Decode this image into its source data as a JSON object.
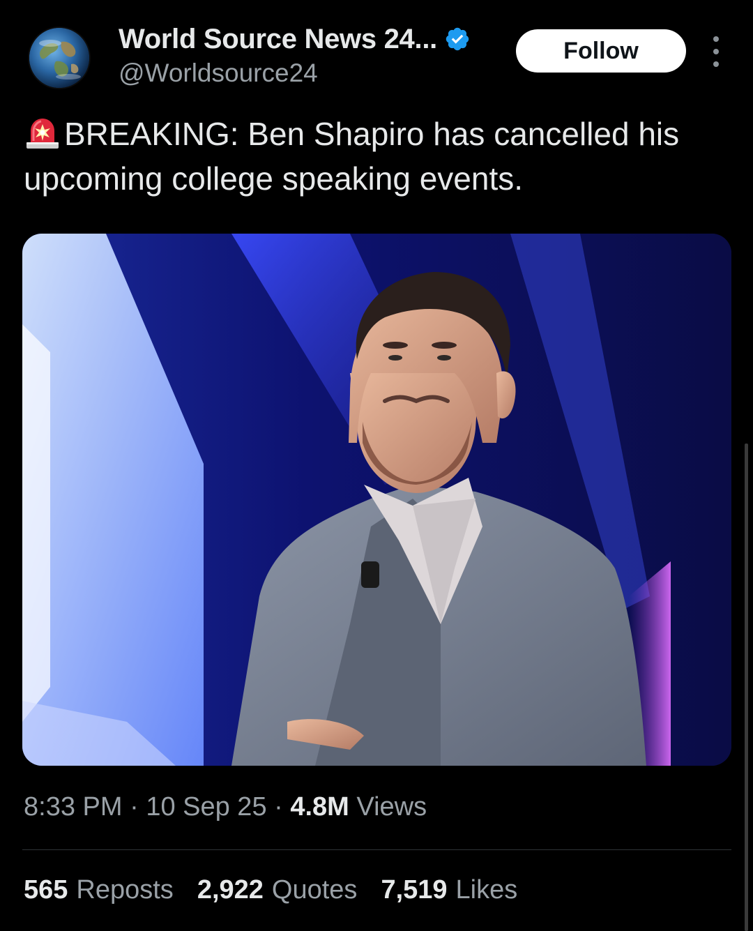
{
  "author": {
    "display_name": "World Source News 24...",
    "handle": "@Worldsource24",
    "avatar_icon": "globe-icon",
    "verified": true,
    "verified_color": "#1d9bf0"
  },
  "actions": {
    "follow_label": "Follow",
    "more_icon": "more-vertical-icon"
  },
  "tweet": {
    "emoji_icon": "siren-icon",
    "text": "BREAKING: Ben Shapiro has cancelled his upcoming college speaking events."
  },
  "media": {
    "type": "photo"
  },
  "meta": {
    "time": "8:33 PM",
    "date": "10 Sep 25",
    "views_count": "4.8M",
    "views_label": "Views"
  },
  "stats": {
    "reposts_count": "565",
    "reposts_label": "Reposts",
    "quotes_count": "2,922",
    "quotes_label": "Quotes",
    "likes_count": "7,519",
    "likes_label": "Likes"
  },
  "colors": {
    "background": "#000000",
    "text_primary": "#e7e9ea",
    "text_secondary": "#9aa1a7",
    "divider": "#2f3336"
  }
}
